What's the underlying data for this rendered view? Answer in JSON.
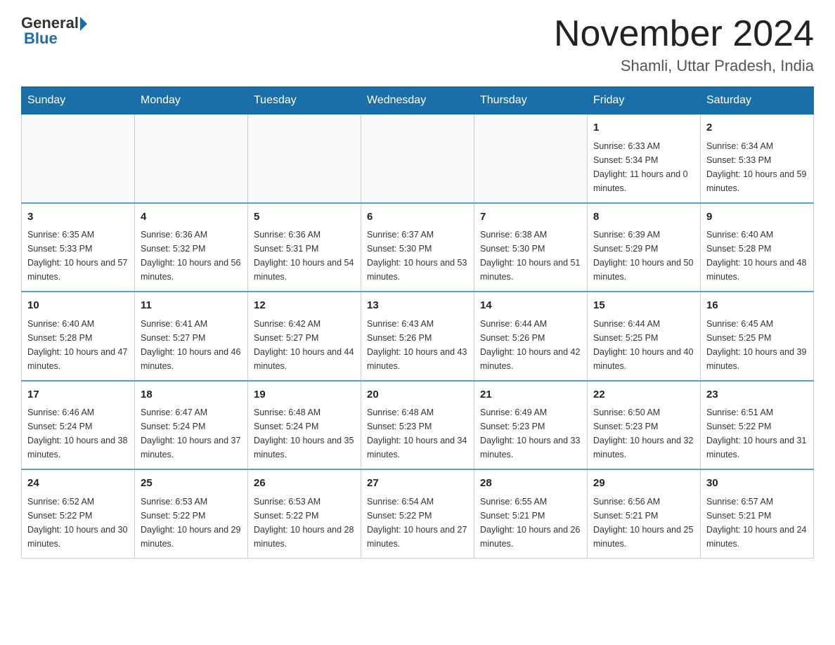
{
  "header": {
    "logo": {
      "general_text": "General",
      "blue_text": "Blue"
    },
    "title": "November 2024",
    "location": "Shamli, Uttar Pradesh, India"
  },
  "calendar": {
    "days_of_week": [
      "Sunday",
      "Monday",
      "Tuesday",
      "Wednesday",
      "Thursday",
      "Friday",
      "Saturday"
    ],
    "weeks": [
      [
        {
          "day": "",
          "info": ""
        },
        {
          "day": "",
          "info": ""
        },
        {
          "day": "",
          "info": ""
        },
        {
          "day": "",
          "info": ""
        },
        {
          "day": "",
          "info": ""
        },
        {
          "day": "1",
          "info": "Sunrise: 6:33 AM\nSunset: 5:34 PM\nDaylight: 11 hours and 0 minutes."
        },
        {
          "day": "2",
          "info": "Sunrise: 6:34 AM\nSunset: 5:33 PM\nDaylight: 10 hours and 59 minutes."
        }
      ],
      [
        {
          "day": "3",
          "info": "Sunrise: 6:35 AM\nSunset: 5:33 PM\nDaylight: 10 hours and 57 minutes."
        },
        {
          "day": "4",
          "info": "Sunrise: 6:36 AM\nSunset: 5:32 PM\nDaylight: 10 hours and 56 minutes."
        },
        {
          "day": "5",
          "info": "Sunrise: 6:36 AM\nSunset: 5:31 PM\nDaylight: 10 hours and 54 minutes."
        },
        {
          "day": "6",
          "info": "Sunrise: 6:37 AM\nSunset: 5:30 PM\nDaylight: 10 hours and 53 minutes."
        },
        {
          "day": "7",
          "info": "Sunrise: 6:38 AM\nSunset: 5:30 PM\nDaylight: 10 hours and 51 minutes."
        },
        {
          "day": "8",
          "info": "Sunrise: 6:39 AM\nSunset: 5:29 PM\nDaylight: 10 hours and 50 minutes."
        },
        {
          "day": "9",
          "info": "Sunrise: 6:40 AM\nSunset: 5:28 PM\nDaylight: 10 hours and 48 minutes."
        }
      ],
      [
        {
          "day": "10",
          "info": "Sunrise: 6:40 AM\nSunset: 5:28 PM\nDaylight: 10 hours and 47 minutes."
        },
        {
          "day": "11",
          "info": "Sunrise: 6:41 AM\nSunset: 5:27 PM\nDaylight: 10 hours and 46 minutes."
        },
        {
          "day": "12",
          "info": "Sunrise: 6:42 AM\nSunset: 5:27 PM\nDaylight: 10 hours and 44 minutes."
        },
        {
          "day": "13",
          "info": "Sunrise: 6:43 AM\nSunset: 5:26 PM\nDaylight: 10 hours and 43 minutes."
        },
        {
          "day": "14",
          "info": "Sunrise: 6:44 AM\nSunset: 5:26 PM\nDaylight: 10 hours and 42 minutes."
        },
        {
          "day": "15",
          "info": "Sunrise: 6:44 AM\nSunset: 5:25 PM\nDaylight: 10 hours and 40 minutes."
        },
        {
          "day": "16",
          "info": "Sunrise: 6:45 AM\nSunset: 5:25 PM\nDaylight: 10 hours and 39 minutes."
        }
      ],
      [
        {
          "day": "17",
          "info": "Sunrise: 6:46 AM\nSunset: 5:24 PM\nDaylight: 10 hours and 38 minutes."
        },
        {
          "day": "18",
          "info": "Sunrise: 6:47 AM\nSunset: 5:24 PM\nDaylight: 10 hours and 37 minutes."
        },
        {
          "day": "19",
          "info": "Sunrise: 6:48 AM\nSunset: 5:24 PM\nDaylight: 10 hours and 35 minutes."
        },
        {
          "day": "20",
          "info": "Sunrise: 6:48 AM\nSunset: 5:23 PM\nDaylight: 10 hours and 34 minutes."
        },
        {
          "day": "21",
          "info": "Sunrise: 6:49 AM\nSunset: 5:23 PM\nDaylight: 10 hours and 33 minutes."
        },
        {
          "day": "22",
          "info": "Sunrise: 6:50 AM\nSunset: 5:23 PM\nDaylight: 10 hours and 32 minutes."
        },
        {
          "day": "23",
          "info": "Sunrise: 6:51 AM\nSunset: 5:22 PM\nDaylight: 10 hours and 31 minutes."
        }
      ],
      [
        {
          "day": "24",
          "info": "Sunrise: 6:52 AM\nSunset: 5:22 PM\nDaylight: 10 hours and 30 minutes."
        },
        {
          "day": "25",
          "info": "Sunrise: 6:53 AM\nSunset: 5:22 PM\nDaylight: 10 hours and 29 minutes."
        },
        {
          "day": "26",
          "info": "Sunrise: 6:53 AM\nSunset: 5:22 PM\nDaylight: 10 hours and 28 minutes."
        },
        {
          "day": "27",
          "info": "Sunrise: 6:54 AM\nSunset: 5:22 PM\nDaylight: 10 hours and 27 minutes."
        },
        {
          "day": "28",
          "info": "Sunrise: 6:55 AM\nSunset: 5:21 PM\nDaylight: 10 hours and 26 minutes."
        },
        {
          "day": "29",
          "info": "Sunrise: 6:56 AM\nSunset: 5:21 PM\nDaylight: 10 hours and 25 minutes."
        },
        {
          "day": "30",
          "info": "Sunrise: 6:57 AM\nSunset: 5:21 PM\nDaylight: 10 hours and 24 minutes."
        }
      ]
    ]
  }
}
